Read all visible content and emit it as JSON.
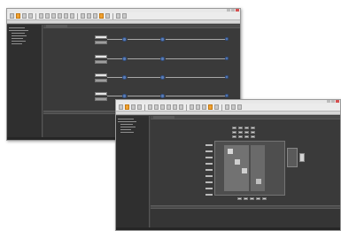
{
  "window_back": {
    "tab_label": "",
    "chain_rows": 4
  },
  "window_front": {
    "tab_label": ""
  },
  "colors": {
    "accent": "#f0a030",
    "canvas": "#3a3a3a",
    "node": "#5d7fb8"
  }
}
